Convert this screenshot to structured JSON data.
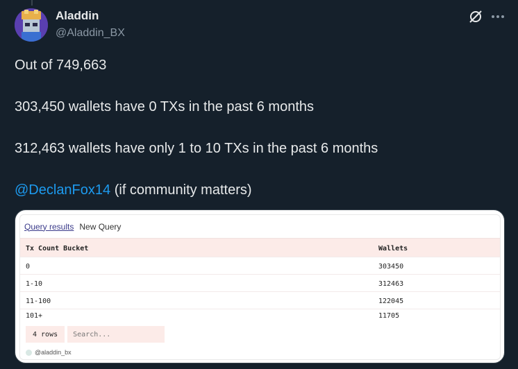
{
  "author": {
    "display_name": "Aladdin",
    "handle": "@Aladdin_BX"
  },
  "icons": {
    "grok": "grok-icon",
    "more": "more-icon"
  },
  "tweet": {
    "line1": "Out of 749,663",
    "line2": "303,450 wallets have 0 TXs in the past 6 months",
    "line3": "312,463 wallets have only 1 to 10 TXs in the past 6 months",
    "mention": "@DeclanFox14",
    "mention_suffix": " (if community matters)"
  },
  "colors": {
    "background": "#15202b",
    "mention": "#1d9bf0",
    "table_header": "#fcebe8"
  },
  "media": {
    "tabs": [
      "Query results",
      "New Query"
    ],
    "columns": [
      "Tx Count Bucket",
      "Wallets"
    ],
    "rows": [
      [
        "0",
        "303450"
      ],
      [
        "1-10",
        "312463"
      ],
      [
        "11-100",
        "122045"
      ],
      [
        "101+",
        "11705"
      ]
    ],
    "row_count": "4 rows",
    "search_placeholder": "Search...",
    "watermark": "@aladdin_bx"
  }
}
